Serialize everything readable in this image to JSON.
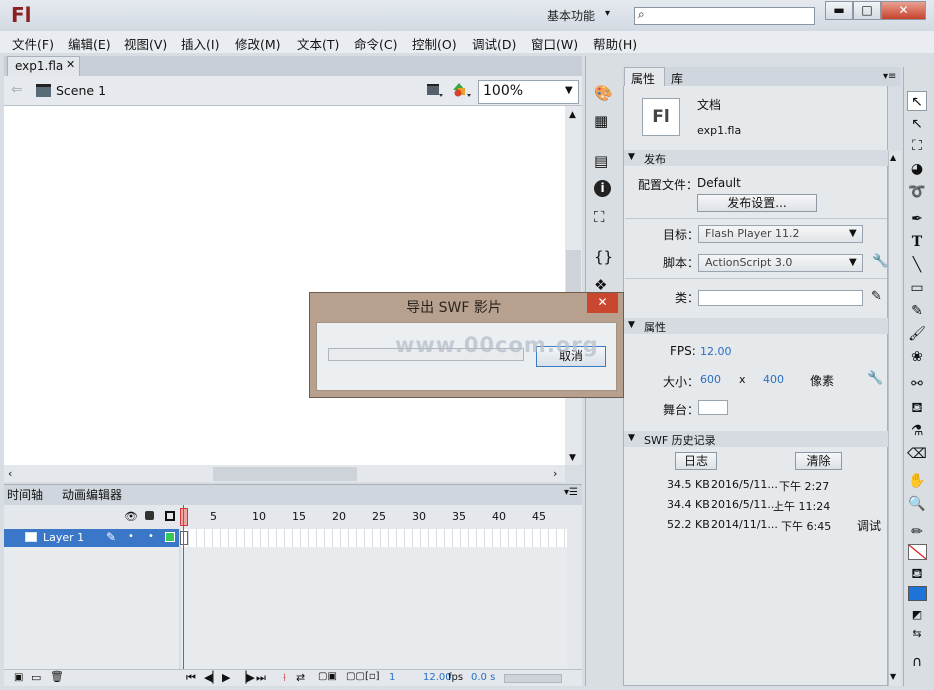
{
  "app": {
    "logo": "Fl",
    "workspace": "基本功能",
    "workspace_chevron": "▾",
    "search_placeholder": ""
  },
  "window_buttons": {
    "minimize": "▬",
    "maximize": "□",
    "close": "✕"
  },
  "menu": [
    "文件(F)",
    "编辑(E)",
    "视图(V)",
    "插入(I)",
    "修改(M)",
    "文本(T)",
    "命令(C)",
    "控制(O)",
    "调试(D)",
    "窗口(W)",
    "帮助(H)"
  ],
  "document": {
    "tab": "exp1.fla",
    "tab_close": "✕",
    "scene": "Scene 1",
    "zoom": "100%"
  },
  "timeline": {
    "tabs": [
      "时间轴",
      "动画编辑器"
    ],
    "frame_numbers": [
      "1",
      "5",
      "10",
      "15",
      "20",
      "25",
      "30",
      "35",
      "40",
      "45"
    ],
    "layer_name": "Layer 1",
    "current_frame": "1",
    "fps": "12.00",
    "fps_unit": "fps",
    "time": "0.0 s"
  },
  "properties": {
    "tabs": [
      "属性",
      "库"
    ],
    "doc_icon": "Fl",
    "doc_type": "文档",
    "doc_name": "exp1.fla",
    "publish_header": "发布",
    "profile_label": "配置文件：",
    "profile_value": "Default",
    "publish_settings_btn": "发布设置...",
    "target_label": "目标：",
    "target_value": "Flash Player 11.2",
    "script_label": "脚本：",
    "script_value": "ActionScript 3.0",
    "class_label": "类：",
    "props_header": "属性",
    "fps_label": "FPS:",
    "fps_value": "12.00",
    "size_label": "大小：",
    "width": "600",
    "x": "x",
    "height": "400",
    "unit": "像素",
    "stage_label": "舞台：",
    "stage_color": "#ffffff",
    "swf_history_header": "SWF 历史记录",
    "log_btn": "日志",
    "clear_btn": "清除",
    "history": [
      {
        "size": "34.5 KB",
        "date": "2016/5/11...",
        "time": "下午 2:27",
        "note": ""
      },
      {
        "size": "34.4 KB",
        "date": "2016/5/11...",
        "time": "上午 11:24",
        "note": ""
      },
      {
        "size": "52.2 KB",
        "date": "2014/11/1...",
        "time": "下午 6:45",
        "note": "调试"
      }
    ]
  },
  "dialog": {
    "title": "导出 SWF 影片",
    "close": "✕",
    "cancel": "取消",
    "progress": 0.0
  },
  "watermark": "www.00com.org",
  "colors": {
    "accent": "#3a77c8",
    "dialog_frame": "#b7a08e",
    "playhead": "#e23b3b",
    "fill_color": "#1e73d8",
    "stroke_color": "#ffffff"
  }
}
